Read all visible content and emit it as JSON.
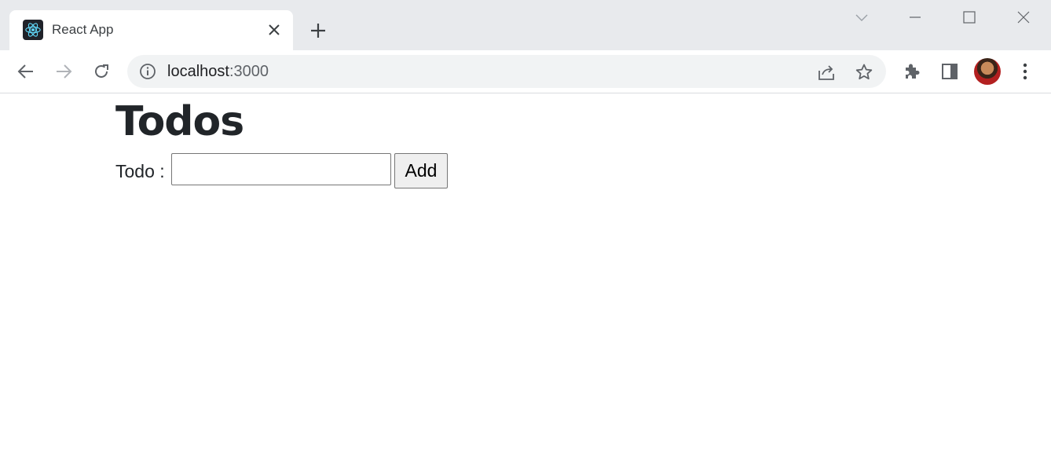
{
  "browser": {
    "tab": {
      "title": "React App",
      "favicon_icon": "react-atom-icon",
      "close_icon": "close-icon"
    },
    "new_tab_icon": "plus-icon",
    "window_controls": [
      "chevron-down-icon",
      "minimize-icon",
      "maximize-icon",
      "close-icon"
    ],
    "toolbar": {
      "back_icon": "arrow-left-icon",
      "forward_icon": "arrow-right-icon",
      "reload_icon": "reload-icon",
      "site_info_icon": "info-icon",
      "url_host": "localhost",
      "url_port": ":3000",
      "share_icon": "share-icon",
      "bookmark_icon": "star-icon",
      "extensions_icon": "puzzle-icon",
      "side_panel_icon": "side-panel-icon",
      "avatar": "profile-avatar",
      "menu_icon": "kebab-menu-icon"
    },
    "colors": {
      "tabstrip_bg": "#e8eaed",
      "omnibox_bg": "#f1f3f4",
      "icon": "#5f6368"
    }
  },
  "page": {
    "title": "Todos",
    "form": {
      "label": "Todo :",
      "input_value": "",
      "add_label": "Add"
    }
  }
}
